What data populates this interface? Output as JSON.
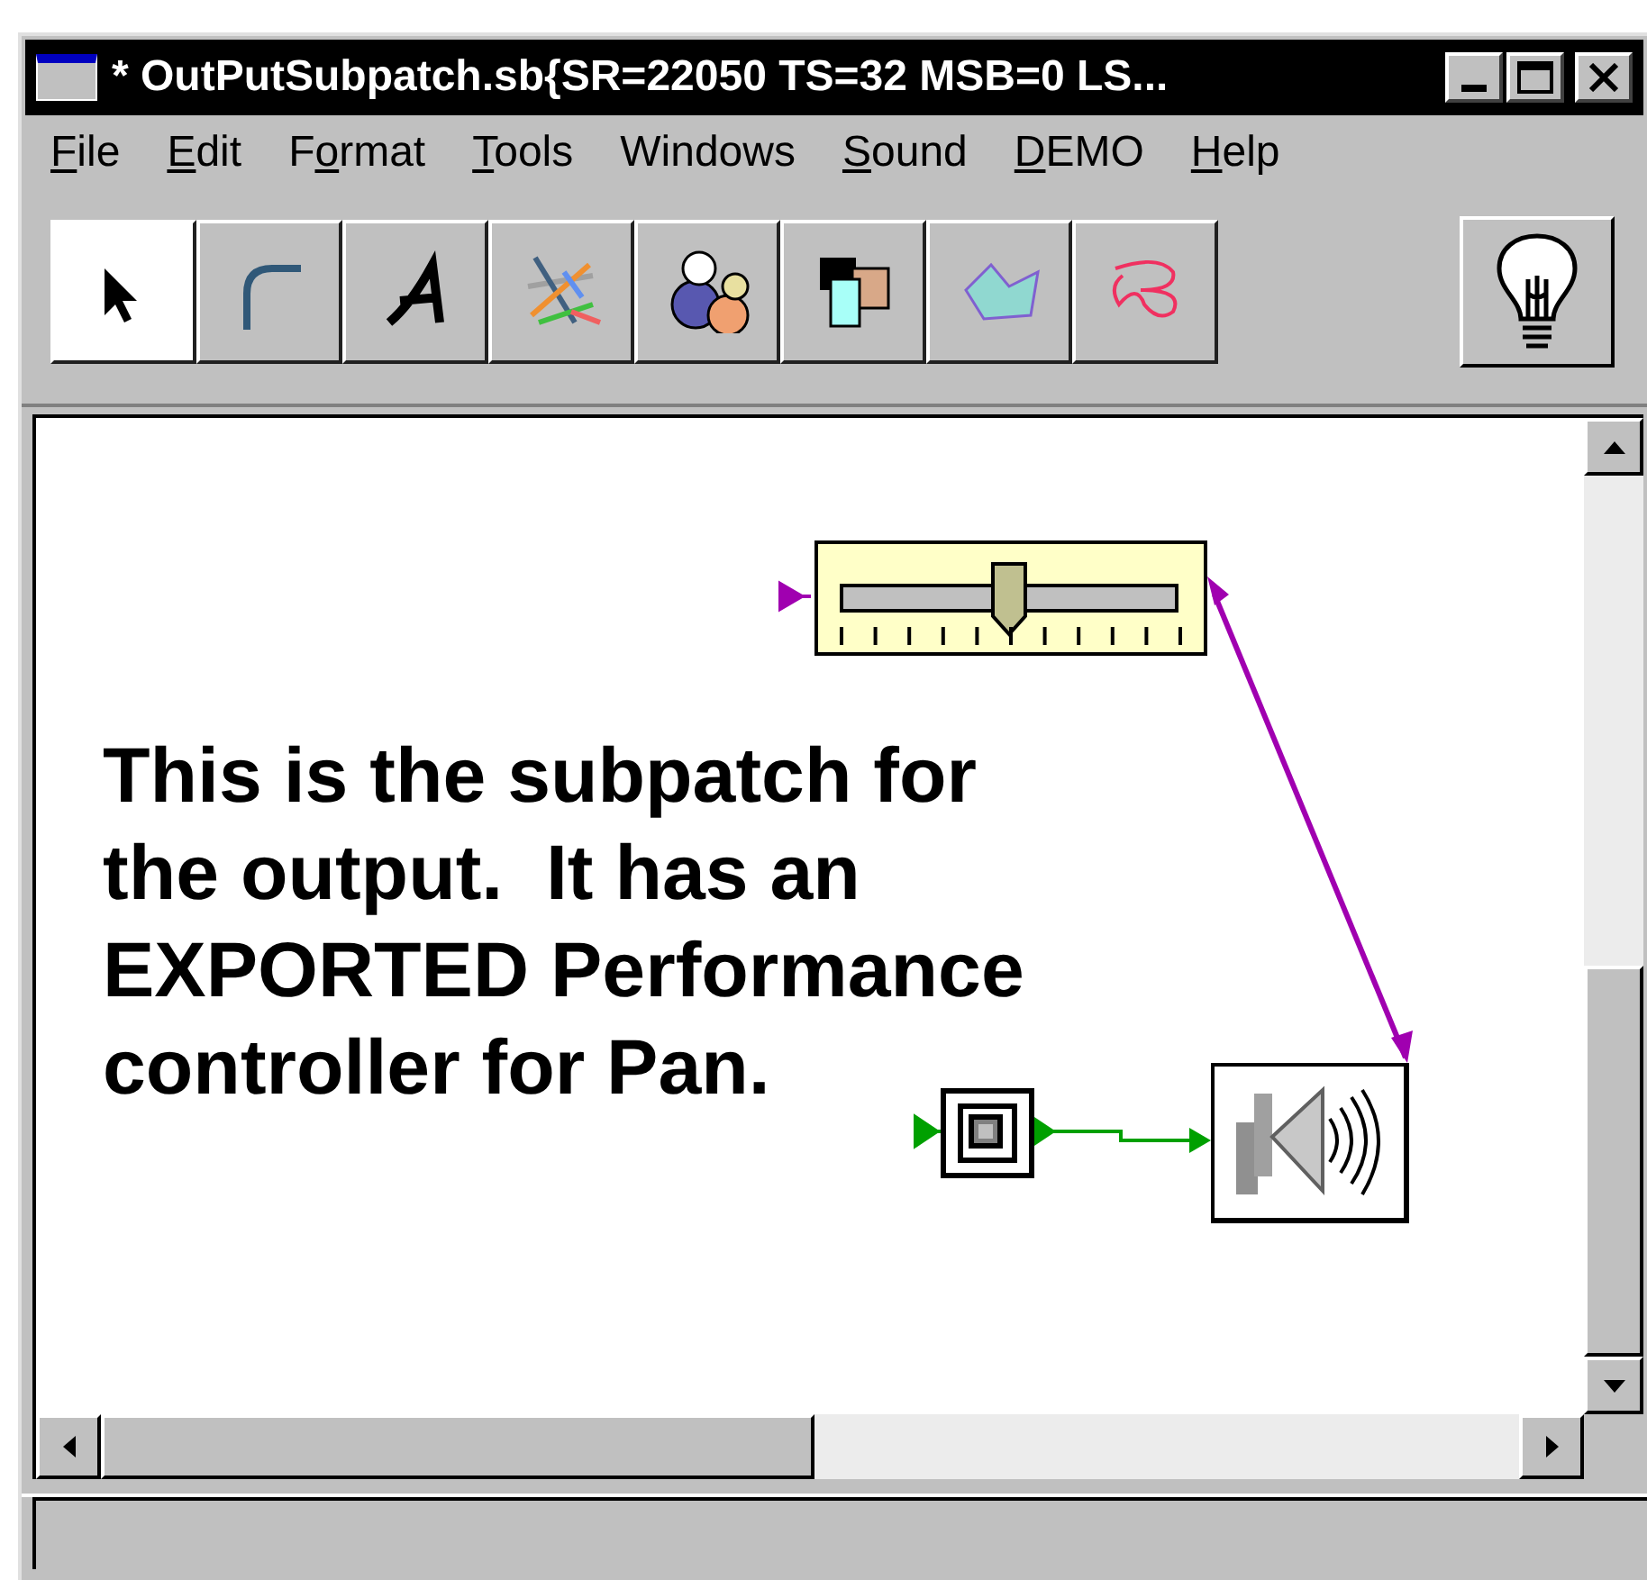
{
  "window": {
    "title": "*  OutPutSubpatch.sb{SR=22050 TS=32 MSB=0 LS..."
  },
  "menu": [
    {
      "parts": [
        {
          "text": "F",
          "underlined": true
        },
        {
          "text": "ile",
          "underlined": false
        }
      ]
    },
    {
      "parts": [
        {
          "text": "E",
          "underlined": true
        },
        {
          "text": "dit",
          "underlined": false
        }
      ]
    },
    {
      "parts": [
        {
          "text": "F",
          "underlined": false
        },
        {
          "text": "o",
          "underlined": true
        },
        {
          "text": "rmat",
          "underlined": false
        }
      ]
    },
    {
      "parts": [
        {
          "text": "T",
          "underlined": true
        },
        {
          "text": "ools",
          "underlined": false
        }
      ]
    },
    {
      "parts": [
        {
          "text": "Windows",
          "underlined": false
        }
      ]
    },
    {
      "parts": [
        {
          "text": "S",
          "underlined": true
        },
        {
          "text": "ound",
          "underlined": false
        }
      ]
    },
    {
      "parts": [
        {
          "text": "D",
          "underlined": true
        },
        {
          "text": "EMO",
          "underlined": false
        }
      ]
    },
    {
      "parts": [
        {
          "text": "H",
          "underlined": true
        },
        {
          "text": "elp",
          "underlined": false
        }
      ]
    }
  ],
  "tools": [
    {
      "kind": "arrow",
      "selected": true
    },
    {
      "kind": "curve",
      "selected": false
    },
    {
      "kind": "text",
      "selected": false
    },
    {
      "kind": "lines",
      "selected": false
    },
    {
      "kind": "circles",
      "selected": false
    },
    {
      "kind": "rectangles",
      "selected": false
    },
    {
      "kind": "polygon",
      "selected": false
    },
    {
      "kind": "freehand",
      "selected": false
    }
  ],
  "canvas": {
    "note": "This is the subpatch for the output.  It has an EXPORTED Performance controller for Pan.",
    "slider": {
      "level": 0.5
    }
  }
}
